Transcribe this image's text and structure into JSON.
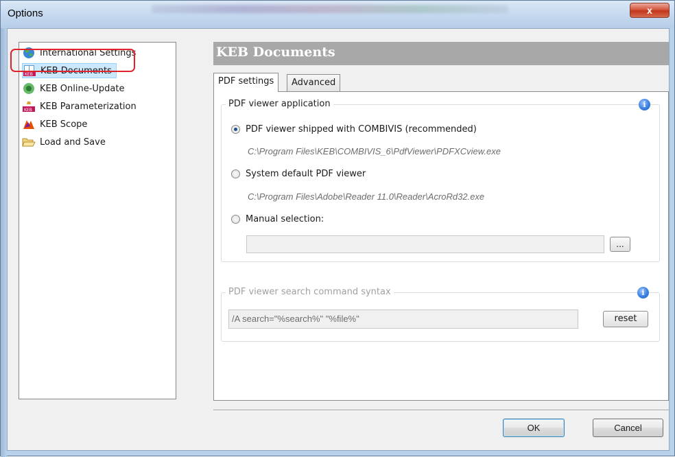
{
  "window": {
    "title": "Options",
    "close_glyph": "x"
  },
  "tree": {
    "items": [
      {
        "label": "International Settings",
        "icon": "globe-icon"
      },
      {
        "label": "KEB Documents",
        "icon": "keb-documents-icon",
        "selected": true
      },
      {
        "label": "KEB Online-Update",
        "icon": "online-update-icon"
      },
      {
        "label": "KEB Parameterization",
        "icon": "parameterization-icon"
      },
      {
        "label": "KEB Scope",
        "icon": "scope-icon"
      },
      {
        "label": "Load and Save",
        "icon": "open-folder-icon"
      }
    ]
  },
  "panel": {
    "header": "KEB Documents",
    "tabs": [
      {
        "label": "PDF settings",
        "active": true
      },
      {
        "label": "Advanced",
        "active": false
      }
    ]
  },
  "viewer_group": {
    "title": "PDF viewer application",
    "info_glyph": "i",
    "options": [
      {
        "label": "PDF viewer shipped with COMBIVIS (recommended)",
        "checked": true,
        "path": "C:\\Program Files\\KEB\\COMBIVIS_6\\PdfViewer\\PDFXCview.exe"
      },
      {
        "label": "System default PDF viewer",
        "checked": false,
        "path": "C:\\Program Files\\Adobe\\Reader 11.0\\Reader\\AcroRd32.exe"
      },
      {
        "label": "Manual selection:",
        "checked": false,
        "path": ""
      }
    ],
    "manual_value": "",
    "browse_label": "..."
  },
  "search_group": {
    "title": "PDF viewer search command syntax",
    "info_glyph": "i",
    "value": "/A search=\"%search%\" \"%file%\"",
    "reset_label": "reset"
  },
  "buttons": {
    "ok": "OK",
    "cancel": "Cancel"
  },
  "colors": {
    "header_bg": "#a8a8a8",
    "selection_bg": "#cce8ff",
    "highlight_ring": "#e0222a"
  }
}
